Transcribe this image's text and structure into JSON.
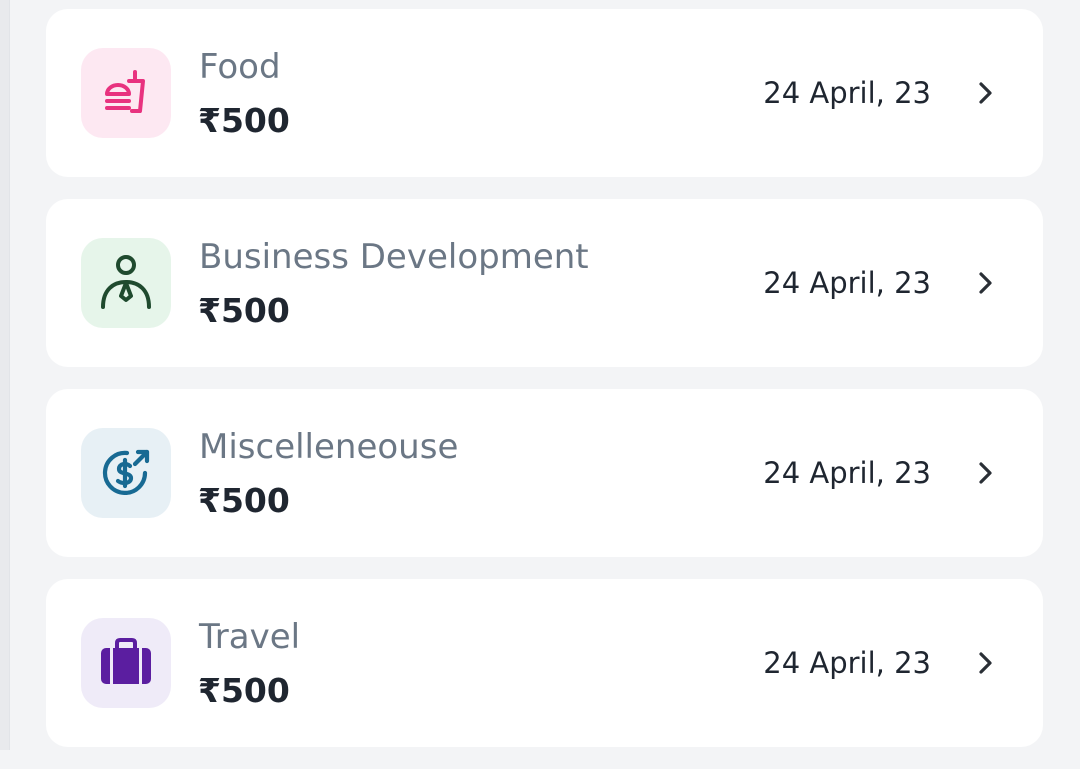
{
  "expenses": [
    {
      "category": "Food",
      "amount": "₹500",
      "date": "24 April, 23",
      "icon": "food-icon",
      "tile_bg": "#fde8f2",
      "icon_color": "#e8327f"
    },
    {
      "category": "Business Development",
      "amount": "₹500",
      "date": "24 April, 23",
      "icon": "business-person-icon",
      "tile_bg": "#e6f5ea",
      "icon_color": "#1f4a2e"
    },
    {
      "category": "Miscelleneouse",
      "amount": "₹500",
      "date": "24 April, 23",
      "icon": "money-exchange-icon",
      "tile_bg": "#e7f0f5",
      "icon_color": "#186a93"
    },
    {
      "category": "Travel",
      "amount": "₹500",
      "date": "24 April, 23",
      "icon": "briefcase-icon",
      "tile_bg": "#efebf8",
      "icon_color": "#5b1ea0"
    }
  ]
}
